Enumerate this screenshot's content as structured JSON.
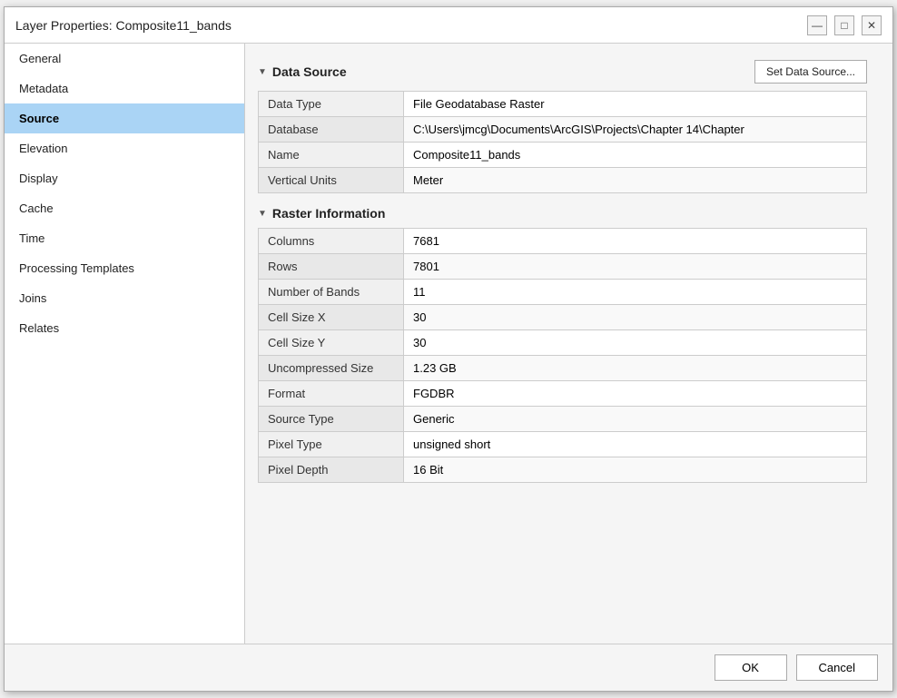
{
  "dialog": {
    "title": "Layer Properties: Composite11_bands",
    "minimize_label": "—",
    "maximize_label": "□",
    "close_label": "✕"
  },
  "sidebar": {
    "items": [
      {
        "id": "general",
        "label": "General",
        "active": false
      },
      {
        "id": "metadata",
        "label": "Metadata",
        "active": false
      },
      {
        "id": "source",
        "label": "Source",
        "active": true
      },
      {
        "id": "elevation",
        "label": "Elevation",
        "active": false
      },
      {
        "id": "display",
        "label": "Display",
        "active": false
      },
      {
        "id": "cache",
        "label": "Cache",
        "active": false
      },
      {
        "id": "time",
        "label": "Time",
        "active": false
      },
      {
        "id": "processing-templates",
        "label": "Processing Templates",
        "active": false
      },
      {
        "id": "joins",
        "label": "Joins",
        "active": false
      },
      {
        "id": "relates",
        "label": "Relates",
        "active": false
      }
    ]
  },
  "content": {
    "set_datasource_label": "Set Data Source...",
    "data_source_section": "Data Source",
    "raster_info_section": "Raster Information",
    "data_source_rows": [
      {
        "label": "Data Type",
        "value": "File Geodatabase Raster"
      },
      {
        "label": "Database",
        "value": "C:\\Users\\jmcg\\Documents\\ArcGIS\\Projects\\Chapter 14\\Chapter"
      },
      {
        "label": "Name",
        "value": "Composite11_bands"
      },
      {
        "label": "Vertical Units",
        "value": "Meter"
      }
    ],
    "raster_info_rows": [
      {
        "label": "Columns",
        "value": "7681"
      },
      {
        "label": "Rows",
        "value": "7801"
      },
      {
        "label": "Number of Bands",
        "value": "11"
      },
      {
        "label": "Cell Size X",
        "value": "30"
      },
      {
        "label": "Cell Size Y",
        "value": "30"
      },
      {
        "label": "Uncompressed Size",
        "value": "1.23 GB"
      },
      {
        "label": "Format",
        "value": "FGDBR"
      },
      {
        "label": "Source Type",
        "value": "Generic"
      },
      {
        "label": "Pixel Type",
        "value": "unsigned short"
      },
      {
        "label": "Pixel Depth",
        "value": "16 Bit"
      }
    ]
  },
  "footer": {
    "ok_label": "OK",
    "cancel_label": "Cancel"
  }
}
